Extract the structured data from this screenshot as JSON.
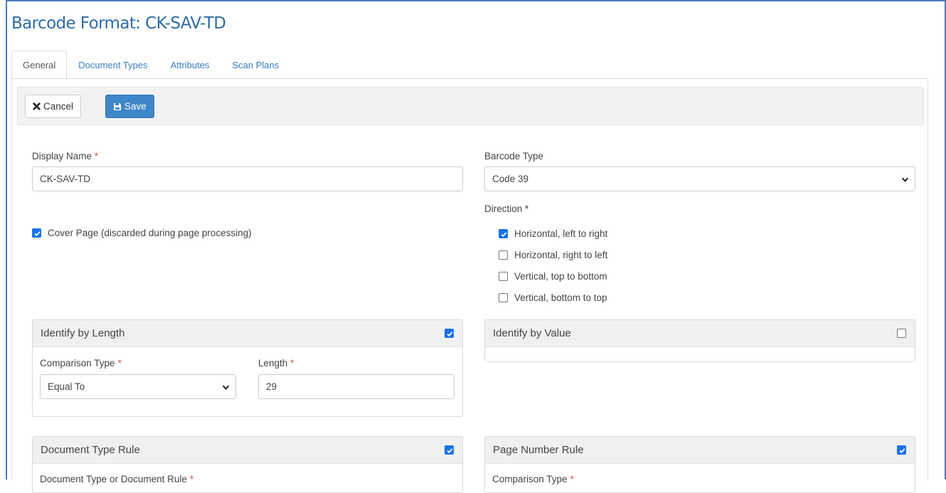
{
  "page": {
    "title": "Barcode Format: CK-SAV-TD"
  },
  "tabs": [
    {
      "label": "General",
      "active": true
    },
    {
      "label": "Document Types",
      "active": false
    },
    {
      "label": "Attributes",
      "active": false
    },
    {
      "label": "Scan Plans",
      "active": false
    }
  ],
  "toolbar": {
    "cancel_label": "Cancel",
    "save_label": "Save"
  },
  "form": {
    "display_name_label": "Display Name",
    "display_name_value": "CK-SAV-TD",
    "required_marker": "*",
    "cover_page_label": "Cover Page (discarded during page processing)",
    "cover_page_checked": true,
    "barcode_type_label": "Barcode Type",
    "barcode_type_value": "Code 39",
    "direction_label": "Direction *",
    "directions": [
      {
        "label": "Horizontal, left to right",
        "checked": true
      },
      {
        "label": "Horizontal, right to left",
        "checked": false
      },
      {
        "label": "Vertical, top to bottom",
        "checked": false
      },
      {
        "label": "Vertical, bottom to top",
        "checked": false
      }
    ]
  },
  "identify_by_length": {
    "title": "Identify by Length",
    "enabled": true,
    "comparison_label": "Comparison Type",
    "comparison_value": "Equal To",
    "length_label": "Length",
    "length_value": "29"
  },
  "identify_by_value": {
    "title": "Identify by Value",
    "enabled": false
  },
  "document_type_rule": {
    "title": "Document Type Rule",
    "enabled": true,
    "field_label": "Document Type or Document Rule"
  },
  "page_number_rule": {
    "title": "Page Number Rule",
    "enabled": true,
    "field_label": "Comparison Type"
  },
  "colors": {
    "accent": "#3f86c9",
    "title": "#2e6ca7",
    "link": "#3a7bc0",
    "required": "#d9534f",
    "checkbox": "#1a73e8"
  }
}
